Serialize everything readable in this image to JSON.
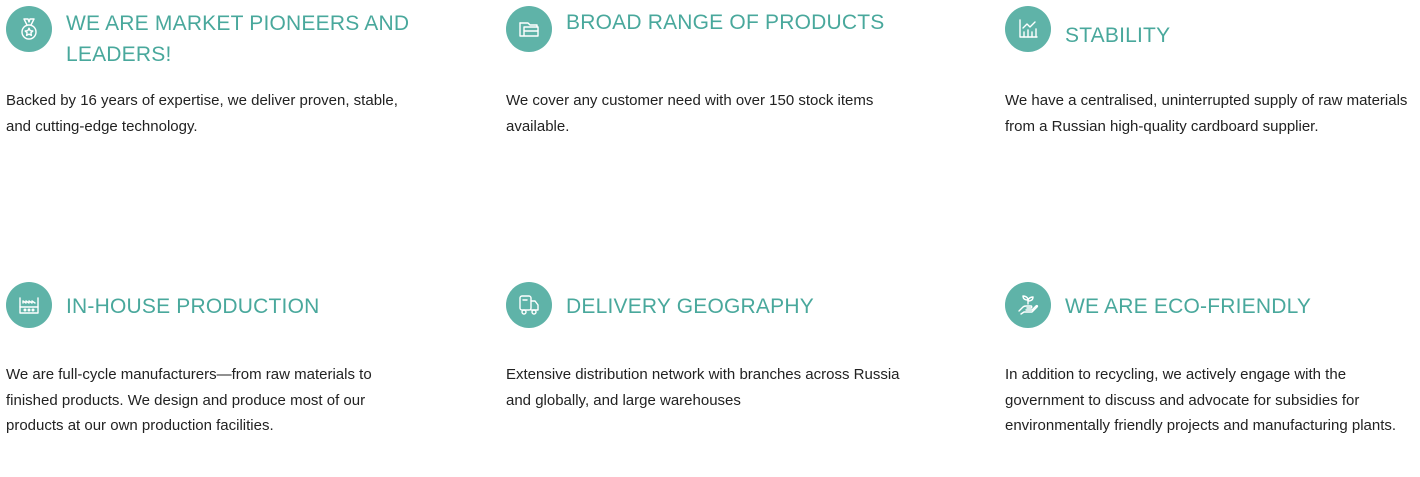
{
  "accent_color": "#49a89c",
  "icon_bg_color": "#5fb3a8",
  "text_color": "#222222",
  "features": [
    {
      "icon": "medal-icon",
      "title": "WE ARE MARKET PIONEERS AND LEADERS!",
      "text": "Backed by 16 years of expertise, we deliver proven, stable, and cutting-edge technology."
    },
    {
      "icon": "products-box-icon",
      "title": "BROAD RANGE OF PRODUCTS",
      "text": "We cover any customer need with over 150 stock items available."
    },
    {
      "icon": "chart-icon",
      "title": "STABILITY",
      "text": "We have a centralised, uninterrupted supply of raw materials from a Russian high-quality cardboard supplier."
    },
    {
      "icon": "factory-icon",
      "title": "IN-HOUSE PRODUCTION",
      "text": "We are full-cycle manufacturers—from raw materials to finished products. We design and produce most of our products at our own production facilities."
    },
    {
      "icon": "truck-icon",
      "title": "DELIVERY GEOGRAPHY",
      "text": "Extensive distribution network with branches across Russia and globally, and large warehouses"
    },
    {
      "icon": "eco-hand-icon",
      "title": "WE ARE ECO-FRIENDLY",
      "text": "In addition to recycling, we actively engage with the government to discuss and advocate for subsidies for environmentally friendly projects and manufacturing plants."
    }
  ]
}
